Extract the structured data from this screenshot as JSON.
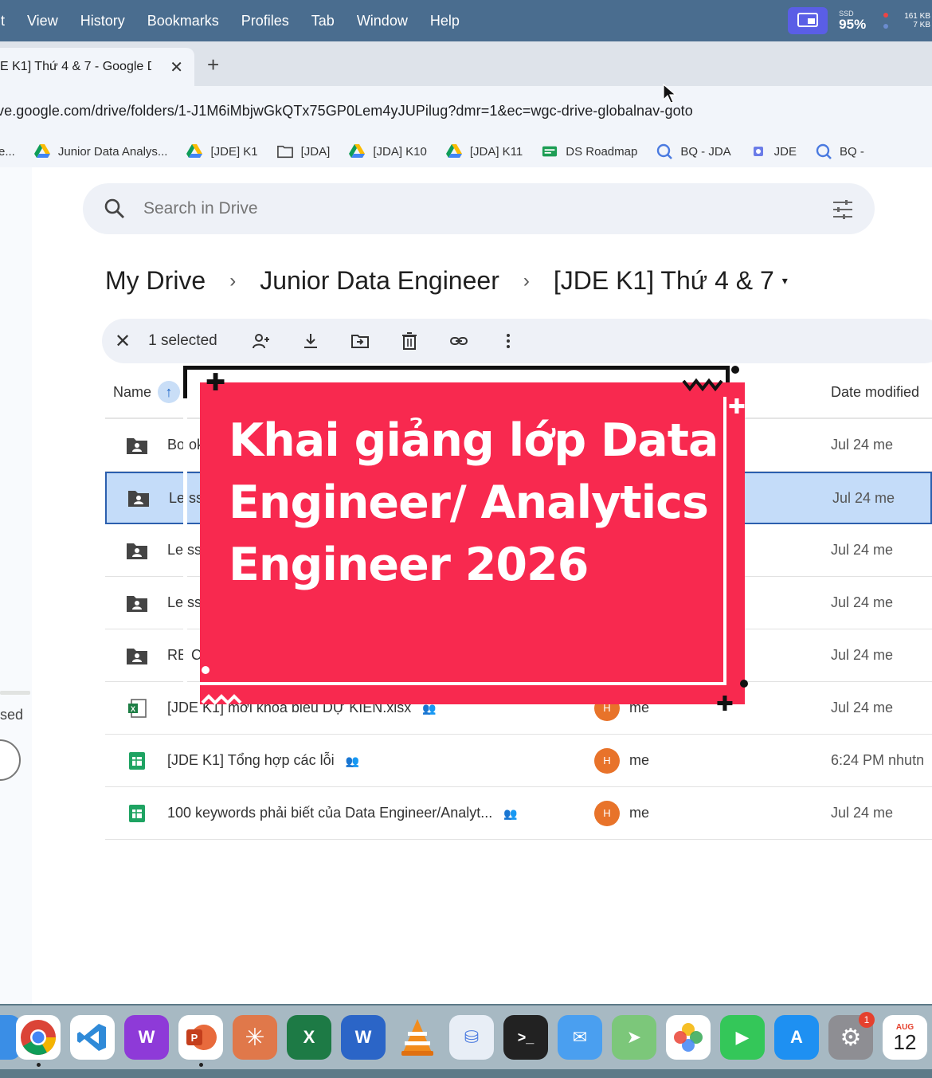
{
  "menubar": {
    "items": [
      "it",
      "View",
      "History",
      "Bookmarks",
      "Profiles",
      "Tab",
      "Window",
      "Help"
    ],
    "ssd_label": "SSD",
    "ssd_value": "95%",
    "net_up": "161 KB",
    "net_down": "7 KB"
  },
  "tab": {
    "title": "E K1] Thứ 4 & 7 - Google D",
    "close": "✕",
    "new_tab": "+"
  },
  "address": {
    "url": "ve.google.com/drive/folders/1-J1M6iMbjwGkQTx75GP0Lem4yJUPilug?dmr=1&ec=wgc-drive-globalnav-goto"
  },
  "bookmarks": [
    {
      "label": "e...",
      "icon": "folder-icon"
    },
    {
      "label": "Junior Data Analys...",
      "icon": "drive-icon"
    },
    {
      "label": "[JDE] K1",
      "icon": "drive-icon"
    },
    {
      "label": "[JDA]",
      "icon": "folder-icon"
    },
    {
      "label": "[JDA] K10",
      "icon": "drive-icon"
    },
    {
      "label": "[JDA] K11",
      "icon": "drive-icon"
    },
    {
      "label": "DS Roadmap",
      "icon": "roadmap-icon"
    },
    {
      "label": "BQ - JDA",
      "icon": "bigquery-icon"
    },
    {
      "label": "JDE",
      "icon": "chip-icon"
    },
    {
      "label": "BQ -",
      "icon": "bigquery-icon"
    }
  ],
  "search": {
    "placeholder": "Search in Drive"
  },
  "breadcrumb": {
    "root": "My Drive",
    "sep": "›",
    "mid": "Junior Data Engineer",
    "current": "[JDE K1] Thứ 4 & 7",
    "dropdown": "▾"
  },
  "actionbar": {
    "close": "✕",
    "selected": "1 selected"
  },
  "table": {
    "name_header": "Name",
    "sort_arrow": "↑",
    "date_header": "Date modified",
    "rows": [
      {
        "name": "Bo ok",
        "type": "folder",
        "owner": "",
        "date": "Jul 24 me"
      },
      {
        "name": "Le ss",
        "type": "folder",
        "owner": "",
        "date": "Jul 24 me"
      },
      {
        "name": "Le ss",
        "type": "folder",
        "owner": "",
        "date": "Jul 24 me"
      },
      {
        "name": "Le ss",
        "type": "folder",
        "owner": "",
        "date": "Jul 24 me"
      },
      {
        "name": "RE C",
        "type": "folder",
        "owner": "",
        "date": "Jul 24 me"
      },
      {
        "name": "[JDE K1] mới khóa biểu DỰ KIẾN.xlsx",
        "type": "excel",
        "owner": "me",
        "date": "Jul 24 me"
      },
      {
        "name": "[JDE K1] Tổng hợp các lỗi",
        "type": "sheet",
        "owner": "me",
        "date": "6:24 PM nhutn"
      },
      {
        "name": "100 keywords phải biết của Data Engineer/Analyt...",
        "type": "sheet",
        "owner": "me",
        "date": "Jul 24 me"
      }
    ],
    "avatar_letter": "H"
  },
  "sidebar": {
    "text": "sed"
  },
  "promo": {
    "title": "Khai giảng lớp Data Engineer/ Analytics Engineer 2026"
  },
  "dock": {
    "badge_count": "1",
    "calendar_month": "AUG",
    "calendar_day": "12"
  },
  "colors": {
    "promo": "#f8294f",
    "selected_row": "#c4dcf9",
    "menubar": "#4a6d8f",
    "avatar": "#e8732a"
  }
}
